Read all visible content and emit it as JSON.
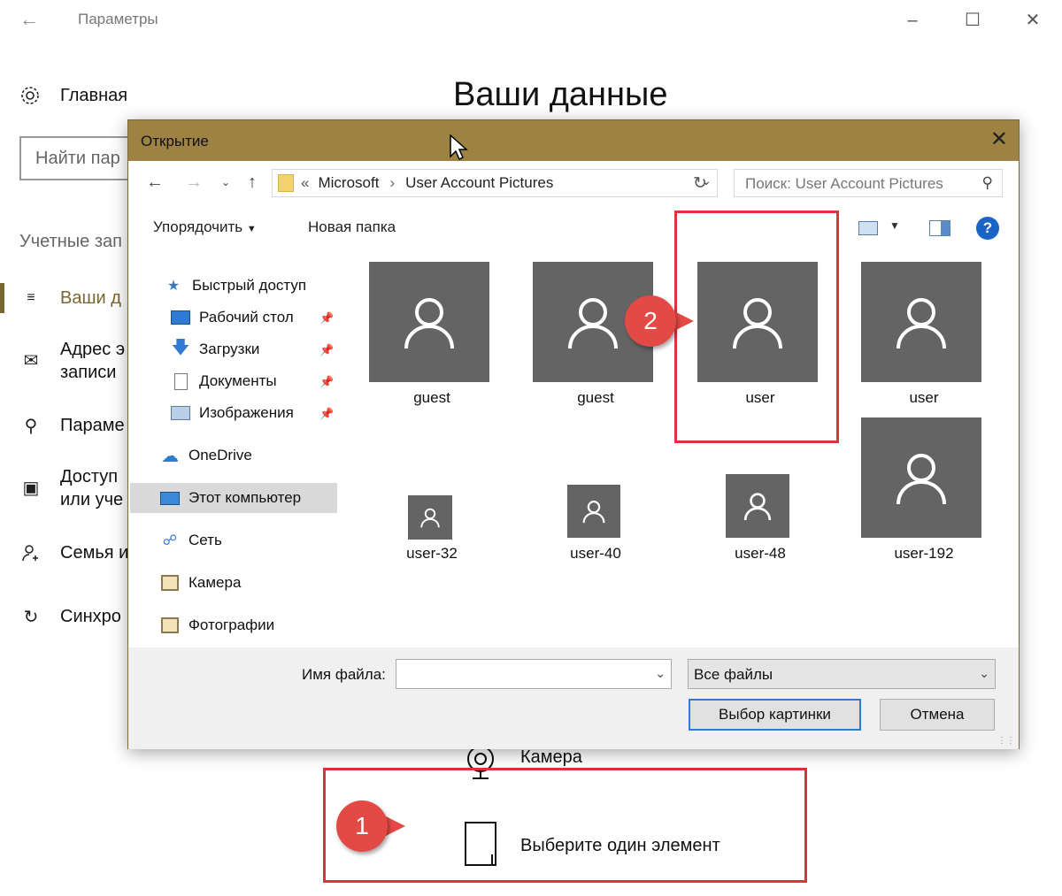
{
  "settings": {
    "window_title": "Параметры",
    "home_label": "Главная",
    "search_placeholder": "Найти пар",
    "section_label": "Учетные зап",
    "items": [
      {
        "label": "Ваши д"
      },
      {
        "label": "Адрес э\nзаписи"
      },
      {
        "label": "Параме"
      },
      {
        "label": "Доступ\nили уче"
      },
      {
        "label": "Семья и"
      },
      {
        "label": "Синхро"
      }
    ],
    "page_title": "Ваши данные",
    "camera_label": "Камера",
    "choose_label": "Выберите один элемент"
  },
  "callouts": {
    "one": "1",
    "two": "2"
  },
  "dialog": {
    "title": "Открытие",
    "breadcrumb": {
      "overflow": "«",
      "parts": [
        "Microsoft",
        "User Account Pictures"
      ]
    },
    "search_placeholder": "Поиск: User Account Pictures",
    "toolbar": {
      "organize": "Упорядочить",
      "new_folder": "Новая папка"
    },
    "nav": [
      {
        "label": "Быстрый доступ",
        "icon": "star-icon"
      },
      {
        "label": "Рабочий стол",
        "icon": "desktop-icon",
        "pinned": true
      },
      {
        "label": "Загрузки",
        "icon": "downloads-icon",
        "pinned": true
      },
      {
        "label": "Документы",
        "icon": "documents-icon",
        "pinned": true
      },
      {
        "label": "Изображения",
        "icon": "pictures-icon",
        "pinned": true
      },
      {
        "label": "OneDrive",
        "icon": "cloud-icon"
      },
      {
        "label": "Этот компьютер",
        "icon": "computer-icon",
        "selected": true
      },
      {
        "label": "Сеть",
        "icon": "network-icon"
      },
      {
        "label": "Камера",
        "icon": "camera-folder-icon"
      },
      {
        "label": "Фотографии",
        "icon": "photos-folder-icon"
      }
    ],
    "files": [
      "guest",
      "guest",
      "user",
      "user",
      "user-32",
      "user-40",
      "user-48",
      "user-192"
    ],
    "filename_label": "Имя файла:",
    "filename_value": "",
    "filter": "Все файлы",
    "ok_button": "Выбор картинки",
    "cancel_button": "Отмена"
  },
  "colors": {
    "accent": "#7a6530",
    "dialog_title": "#9d8243",
    "tile": "#646464",
    "callout": "#e34a45"
  }
}
